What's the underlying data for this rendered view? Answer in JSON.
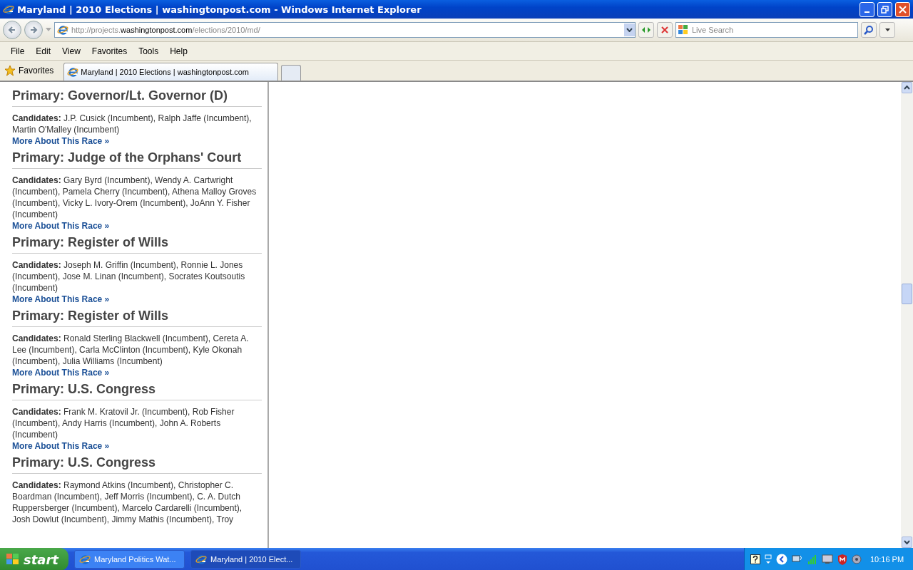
{
  "window": {
    "title": "Maryland | 2010 Elections | washingtonpost.com - Windows Internet Explorer"
  },
  "address_bar": {
    "url_parts": [
      {
        "text": "http://projects.",
        "kind": "dim"
      },
      {
        "text": "washingtonpost.com",
        "kind": "host"
      },
      {
        "text": "/elections/2010/md/",
        "kind": "dim"
      }
    ]
  },
  "search": {
    "placeholder": "Live Search"
  },
  "menu": [
    "File",
    "Edit",
    "View",
    "Favorites",
    "Tools",
    "Help"
  ],
  "favorites": {
    "label": "Favorites"
  },
  "tabs": [
    {
      "label": "Maryland | 2010 Elections | washingtonpost.com",
      "selected": true
    }
  ],
  "races": [
    {
      "title": "Primary: Governor/Lt. Governor (D)",
      "candidates": "**Candidates:** J.P. Cusick (Incumbent), Ralph Jaffe (Incumbent), Martin O'Malley (Incumbent)",
      "link": "More About This Race »"
    },
    {
      "title": "Primary: Judge of the Orphans' Court",
      "candidates": "**Candidates:** Gary Byrd (Incumbent), Wendy A. Cartwright (Incumbent), Pamela Cherry (Incumbent), Athena Malloy Groves (Incumbent), Vicky L. Ivory-Orem (Incumbent), JoAnn Y. Fisher (Incumbent)",
      "link": "More About This Race »"
    },
    {
      "title": "Primary: Register of Wills",
      "candidates": "**Candidates:** Joseph M. Griffin (Incumbent), Ronnie L. Jones (Incumbent), Jose M. Linan (Incumbent), Socrates Koutsoutis (Incumbent)",
      "link": "More About This Race »"
    },
    {
      "title": "Primary: Register of Wills",
      "candidates": "**Candidates:** Ronald Sterling Blackwell (Incumbent), Cereta A. Lee (Incumbent), Carla McClinton (Incumbent), Kyle Okonah (Incumbent), Julia Williams (Incumbent)",
      "link": "More About This Race »"
    },
    {
      "title": "Primary: U.S. Congress",
      "candidates": "**Candidates:** Frank M. Kratovil Jr. (Incumbent), Rob Fisher (Incumbent), Andy Harris (Incumbent), John A. Roberts (Incumbent)",
      "link": "More About This Race »"
    },
    {
      "title": "Primary: U.S. Congress",
      "candidates": "**Candidates:** Raymond Atkins (Incumbent), Christopher C. Boardman (Incumbent), Jeff Morris (Incumbent), C. A. Dutch Ruppersberger (Incumbent), Marcelo Cardarelli (Incumbent), Josh Dowlut (Incumbent), Jimmy Mathis (Incumbent), Troy"
    }
  ],
  "taskbar": {
    "start": "start",
    "buttons": [
      {
        "label": "Maryland Politics Wat...",
        "selected": false
      },
      {
        "label": "Maryland | 2010 Elect...",
        "selected": true
      }
    ],
    "clock": "10:16 PM"
  }
}
